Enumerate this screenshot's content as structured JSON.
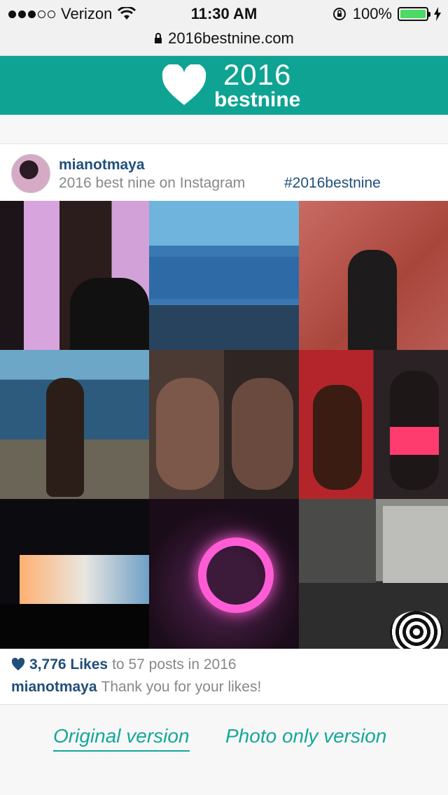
{
  "status_bar": {
    "carrier": "Verizon",
    "time": "11:30 AM",
    "battery": "100%",
    "signal_bars_filled": 3,
    "signal_bars_total": 5
  },
  "url_bar": {
    "url": "2016bestnine.com"
  },
  "brand": {
    "year": "2016",
    "word": "bestnine",
    "color": "#0ea392"
  },
  "post": {
    "username": "mianotmaya",
    "subtitle": "2016 best nine on Instagram",
    "hashtag": "#2016bestnine",
    "likes": "3,776 Likes",
    "posts_text": "to 57 posts in 2016",
    "caption_user": "mianotmaya",
    "caption_text": "Thank you for your likes!"
  },
  "links": {
    "original": "Original version",
    "photo_only": "Photo only version"
  }
}
